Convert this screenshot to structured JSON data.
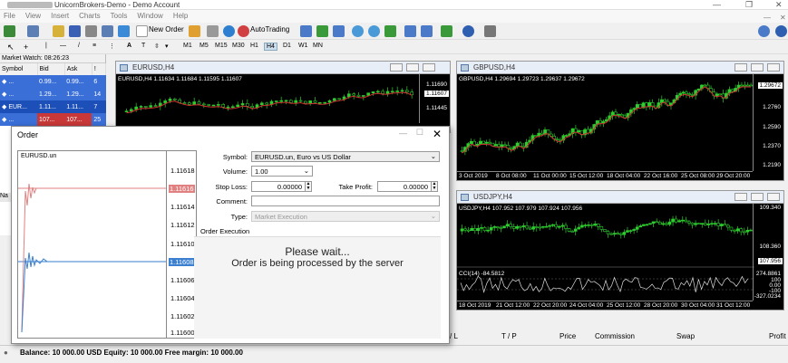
{
  "titlebar": {
    "title": "UnicornBrokers-Demo - Demo Account"
  },
  "menu": [
    "File",
    "View",
    "Insert",
    "Charts",
    "Tools",
    "Window",
    "Help"
  ],
  "toolbar": {
    "new_order": "New Order",
    "autotrading": "AutoTrading",
    "timeframes": [
      "M1",
      "M5",
      "M15",
      "M30",
      "H1",
      "H4",
      "D1",
      "W1",
      "MN"
    ]
  },
  "market_watch": {
    "header": "Market Watch: 08:26:23",
    "columns": [
      "Symbol",
      "Bid",
      "Ask",
      "!"
    ],
    "rows": [
      {
        "symbol": "...",
        "bid": "0.99...",
        "ask": "0.99...",
        "spread": "6"
      },
      {
        "symbol": "...",
        "bid": "1.29...",
        "ask": "1.29...",
        "spread": "14"
      },
      {
        "symbol": "EUR...",
        "bid": "1.11...",
        "ask": "1.11...",
        "spread": "7"
      },
      {
        "symbol": "...",
        "bid": "107...",
        "ask": "107...",
        "spread": "25"
      }
    ],
    "side_tab": "Na"
  },
  "charts": {
    "eurusd": {
      "caption": "EURUSD,H4",
      "info": "EURUSD,H4  1.11634 1.11684 1.11595 1.11607",
      "prices": [
        "1.11690",
        "1.11607",
        "1.11445"
      ]
    },
    "gbpusd": {
      "caption": "GBPUSD,H4",
      "info": "GBPUSD,H4  1.29694 1.29723 1.29637 1.29672",
      "prices": [
        "1.29672",
        "1.2760",
        "1.2590",
        "1.2370",
        "1.2190"
      ],
      "times": [
        "3 Oct 2019",
        "8 Oct 08:00",
        "11 Oct 00:00",
        "15 Oct 12:00",
        "18 Oct 04:00",
        "22 Oct 16:00",
        "25 Oct 08:00",
        "29 Oct 20:00"
      ]
    },
    "usdjpy": {
      "caption": "USDJPY,H4",
      "info": "USDJPY,H4  107.952 107.979 107.924 107.956",
      "prices": [
        "109.340",
        "108.360",
        "107.956"
      ],
      "indicator": "CCI(14) -84.5812",
      "ind_levels": [
        "274.8861",
        "100",
        "0.00",
        "-100",
        "-327.0234"
      ],
      "times": [
        "18 Oct 2019",
        "21 Oct 12:00",
        "22 Oct 20:00",
        "24 Oct 04:00",
        "25 Oct 12:00",
        "28 Oct 20:00",
        "30 Oct 04:00",
        "31 Oct 12:00"
      ]
    }
  },
  "order": {
    "title": "Order",
    "chart_label": "EURUSD.un",
    "chart_prices": [
      "1.11618",
      "1.11616",
      "1.11614",
      "1.11612",
      "1.11610",
      "1.11608",
      "1.11606",
      "1.11604",
      "1.11602",
      "1.11600"
    ],
    "symbol_label": "Symbol:",
    "symbol_value": "EURUSD.un, Euro vs US Dollar",
    "volume_label": "Volume:",
    "volume_value": "1.00",
    "stoploss_label": "Stop Loss:",
    "stoploss_value": "0.00000",
    "takeprofit_label": "Take Profit:",
    "takeprofit_value": "0.00000",
    "comment_label": "Comment:",
    "comment_value": "",
    "type_label": "Type:",
    "type_value": "Market Execution",
    "exec_label": "Order Execution",
    "wait_line1": "Please wait...",
    "wait_line2": "Order is being processed by the server"
  },
  "terminal": {
    "columns": [
      "/ L",
      "T / P",
      "Price",
      "Commission",
      "Swap",
      "Profit"
    ]
  },
  "status": {
    "text": "Balance: 10 000.00 USD  Equity: 10 000.00  Free margin: 10 000.00"
  }
}
